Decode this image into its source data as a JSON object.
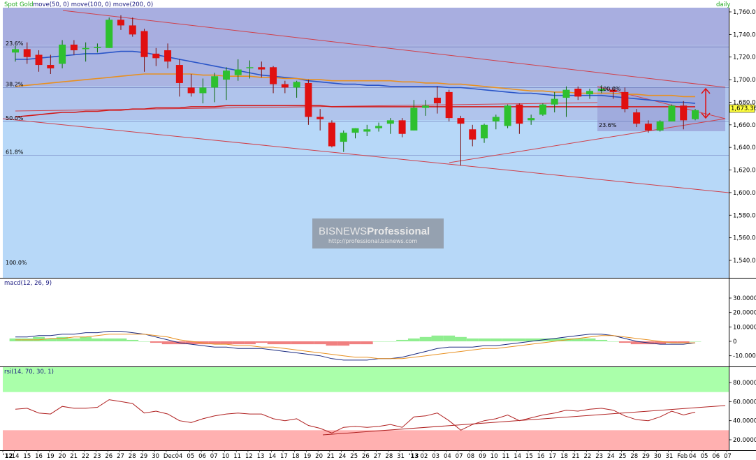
{
  "header": {
    "instrument": "Spot Gold",
    "indicators": "move(50, 0) move(100, 0) move(200, 0)",
    "interval": "daily"
  },
  "colors": {
    "price_bg": "#b7d8f8",
    "fib_band_dark": "#a8b0dc",
    "fib_band_mid": "#aab8e4",
    "bull": "#2ec02e",
    "bear": "#e01010",
    "ma50": "#2a55c8",
    "ma100": "#e89020",
    "ma200": "#d21a1a",
    "trend": "#d0404a",
    "macd_pos": "#90ee90",
    "macd_neg": "#f08080",
    "rsi_over": "#aaffaa",
    "rsi_under": "#ffb0b0",
    "rsi_line": "#b02020"
  },
  "price_panel": {
    "current_price": "1,673.36",
    "y_ticks": [
      "1,760.00",
      "1,740.00",
      "1,720.00",
      "1,700.00",
      "1,680.00",
      "1,660.00",
      "1,640.00",
      "1,620.00",
      "1,600.00",
      "1,580.00",
      "1,560.00",
      "1,540.00"
    ],
    "fib_main": [
      "23.6%",
      "38.2%",
      "50.0%",
      "61.8%",
      "100.0%"
    ],
    "fib_small": [
      "100.0%",
      "23.6%"
    ],
    "watermark_brand": "BISNEWS",
    "watermark_brand2": "Professional",
    "watermark_url": "http://professional.bisnews.com"
  },
  "macd_panel": {
    "title": "macd(12, 26, 9)",
    "y_ticks": [
      "30.0000",
      "20.0000",
      "10.0000",
      "0",
      "-10.0000"
    ]
  },
  "rsi_panel": {
    "title": "rsi(14, 70, 30, 1)",
    "y_ticks": [
      "80.0000",
      "60.0000",
      "40.0000",
      "20.0000"
    ]
  },
  "x_axis": {
    "labels": [
      "'12",
      "14",
      "15",
      "16",
      "19",
      "20",
      "21",
      "22",
      "23",
      "26",
      "27",
      "28",
      "29",
      "30",
      "Dec",
      "04",
      "05",
      "06",
      "07",
      "10",
      "11",
      "12",
      "13",
      "14",
      "17",
      "18",
      "19",
      "20",
      "21",
      "24",
      "25",
      "26",
      "27",
      "28",
      "31",
      "'13",
      "02",
      "03",
      "04",
      "07",
      "08",
      "09",
      "10",
      "11",
      "14",
      "15",
      "16",
      "17",
      "18",
      "21",
      "22",
      "23",
      "24",
      "25",
      "28",
      "29",
      "30",
      "31",
      "Feb",
      "04",
      "05",
      "06",
      "07"
    ]
  },
  "chart_data": {
    "type": "candlestick",
    "title": "Spot Gold daily",
    "x": [
      "14",
      "15",
      "16",
      "19",
      "20",
      "21",
      "22",
      "23",
      "26",
      "27",
      "28",
      "29",
      "30",
      "Dec 03",
      "04",
      "05",
      "06",
      "07",
      "10",
      "11",
      "12",
      "13",
      "14",
      "17",
      "18",
      "19",
      "20",
      "21",
      "24",
      "25",
      "26",
      "27",
      "28",
      "31",
      "'13 01",
      "02",
      "03",
      "04",
      "07",
      "08",
      "09",
      "10",
      "11",
      "14",
      "15",
      "16",
      "17",
      "18",
      "21",
      "22",
      "23",
      "24",
      "25",
      "28",
      "29",
      "30",
      "31",
      "Feb 01",
      "04"
    ],
    "series": [
      {
        "name": "price",
        "ohlc": [
          [
            1724,
            1730,
            1716,
            1727
          ],
          [
            1727,
            1733,
            1714,
            1720
          ],
          [
            1722,
            1726,
            1707,
            1713
          ],
          [
            1713,
            1722,
            1705,
            1710
          ],
          [
            1714,
            1735,
            1710,
            1731
          ],
          [
            1731,
            1735,
            1722,
            1726
          ],
          [
            1727,
            1733,
            1716,
            1728
          ],
          [
            1728,
            1732,
            1724,
            1729
          ],
          [
            1728,
            1755,
            1728,
            1753
          ],
          [
            1753,
            1757,
            1744,
            1748
          ],
          [
            1748,
            1755,
            1738,
            1740
          ],
          [
            1743,
            1745,
            1707,
            1720
          ],
          [
            1723,
            1728,
            1712,
            1719
          ],
          [
            1726,
            1732,
            1710,
            1716
          ],
          [
            1713,
            1718,
            1685,
            1697
          ],
          [
            1693,
            1705,
            1685,
            1688
          ],
          [
            1688,
            1701,
            1679,
            1693
          ],
          [
            1693,
            1706,
            1680,
            1703
          ],
          [
            1700,
            1711,
            1682,
            1708
          ],
          [
            1704,
            1718,
            1699,
            1709
          ],
          [
            1711,
            1717,
            1701,
            1711
          ],
          [
            1711,
            1716,
            1702,
            1709
          ],
          [
            1711,
            1712,
            1688,
            1696
          ],
          [
            1696,
            1699,
            1688,
            1693
          ],
          [
            1693,
            1699,
            1684,
            1698
          ],
          [
            1697,
            1700,
            1660,
            1667
          ],
          [
            1667,
            1674,
            1655,
            1665
          ],
          [
            1662,
            1664,
            1640,
            1641
          ],
          [
            1645,
            1655,
            1636,
            1653
          ],
          [
            1653,
            1657,
            1648,
            1657
          ],
          [
            1654,
            1660,
            1650,
            1656
          ],
          [
            1657,
            1662,
            1654,
            1659
          ],
          [
            1661,
            1666,
            1652,
            1664
          ],
          [
            1664,
            1666,
            1649,
            1652
          ],
          [
            1655,
            1682,
            1655,
            1675
          ],
          [
            1675,
            1682,
            1668,
            1677
          ],
          [
            1684,
            1694,
            1670,
            1679
          ],
          [
            1689,
            1691,
            1663,
            1666
          ],
          [
            1666,
            1668,
            1624,
            1661
          ],
          [
            1656,
            1660,
            1641,
            1647
          ],
          [
            1648,
            1661,
            1644,
            1660
          ],
          [
            1663,
            1669,
            1656,
            1667
          ],
          [
            1659,
            1678,
            1657,
            1677
          ],
          [
            1678,
            1679,
            1652,
            1661
          ],
          [
            1664,
            1669,
            1660,
            1666
          ],
          [
            1669,
            1679,
            1668,
            1678
          ],
          [
            1678,
            1689,
            1671,
            1683
          ],
          [
            1684,
            1694,
            1667,
            1691
          ],
          [
            1692,
            1694,
            1682,
            1685
          ],
          [
            1687,
            1692,
            1683,
            1690
          ],
          [
            1690,
            1695,
            1688,
            1692
          ],
          [
            1691,
            1693,
            1683,
            1689
          ],
          [
            1689,
            1693,
            1671,
            1674
          ],
          [
            1671,
            1674,
            1658,
            1661
          ],
          [
            1661,
            1664,
            1653,
            1655
          ],
          [
            1655,
            1664,
            1654,
            1663
          ],
          [
            1663,
            1678,
            1663,
            1677
          ],
          [
            1677,
            1681,
            1656,
            1664
          ],
          [
            1665,
            1674,
            1664,
            1673
          ]
        ]
      }
    ],
    "moving_averages": [
      {
        "name": "move(50, 0)",
        "values": [
          1718,
          1718,
          1719,
          1720,
          1721,
          1722,
          1723,
          1723,
          1724,
          1725,
          1725,
          1724,
          1722,
          1720,
          1718,
          1716,
          1714,
          1712,
          1710,
          1708,
          1706,
          1704,
          1703,
          1702,
          1701,
          1699,
          1698,
          1697,
          1696,
          1696,
          1695,
          1695,
          1694,
          1694,
          1694,
          1694,
          1694,
          1693,
          1693,
          1692,
          1691,
          1690,
          1689,
          1688,
          1688,
          1687,
          1686,
          1686,
          1686,
          1686,
          1686,
          1685,
          1684,
          1683,
          1682,
          1681,
          1680,
          1680,
          1679
        ]
      },
      {
        "name": "move(100, 0)",
        "values": [
          1694,
          1695,
          1696,
          1697,
          1698,
          1699,
          1700,
          1701,
          1702,
          1703,
          1704,
          1705,
          1705,
          1705,
          1705,
          1705,
          1704,
          1704,
          1703,
          1703,
          1703,
          1702,
          1702,
          1701,
          1701,
          1700,
          1700,
          1699,
          1699,
          1699,
          1699,
          1699,
          1699,
          1698,
          1698,
          1697,
          1697,
          1696,
          1696,
          1695,
          1694,
          1693,
          1692,
          1691,
          1690,
          1690,
          1689,
          1689,
          1688,
          1688,
          1688,
          1688,
          1687,
          1687,
          1686,
          1686,
          1686,
          1685,
          1685
        ]
      },
      {
        "name": "move(200, 0)",
        "values": [
          1667,
          1668,
          1669,
          1670,
          1671,
          1671,
          1672,
          1672,
          1673,
          1673,
          1674,
          1674,
          1675,
          1675,
          1675,
          1676,
          1676,
          1676,
          1677,
          1677,
          1677,
          1677,
          1677,
          1677,
          1677,
          1677,
          1677,
          1676,
          1676,
          1676,
          1676,
          1676,
          1676,
          1676,
          1676,
          1676,
          1676,
          1676,
          1676,
          1676,
          1676,
          1676,
          1676,
          1676,
          1676,
          1676,
          1676,
          1676,
          1676,
          1676,
          1676,
          1676,
          1676,
          1676,
          1676,
          1676,
          1676,
          1676,
          1676
        ]
      }
    ],
    "fibonacci_levels": {
      "23.6%": 1729,
      "38.2%": 1693,
      "50.0%": 1663,
      "61.8%": 1633,
      "100.0%": 1540
    },
    "macd": {
      "series": [
        {
          "name": "macd",
          "values": [
            3,
            3,
            4,
            4,
            5,
            5,
            6,
            6,
            7,
            7,
            6,
            5,
            3,
            1,
            -1,
            -2,
            -3,
            -4,
            -4,
            -5,
            -5,
            -5,
            -6,
            -7,
            -8,
            -9,
            -10,
            -12,
            -13,
            -13,
            -13,
            -12,
            -12,
            -11,
            -9,
            -7,
            -5,
            -4,
            -4,
            -4,
            -3,
            -3,
            -2,
            -1,
            0,
            1,
            2,
            3,
            4,
            5,
            5,
            4,
            2,
            0,
            -1,
            -2,
            -2,
            -2,
            -1
          ]
        },
        {
          "name": "signal",
          "values": [
            1,
            1,
            1,
            2,
            2,
            3,
            3,
            4,
            5,
            5,
            5,
            5,
            4,
            3,
            1,
            0,
            -1,
            -2,
            -2,
            -3,
            -3,
            -4,
            -4,
            -5,
            -6,
            -7,
            -8,
            -9,
            -10,
            -11,
            -11,
            -12,
            -12,
            -12,
            -11,
            -10,
            -9,
            -8,
            -7,
            -6,
            -5,
            -5,
            -4,
            -3,
            -2,
            -1,
            0,
            1,
            2,
            3,
            4,
            4,
            3,
            2,
            1,
            0,
            -1,
            -1,
            -1
          ]
        }
      ],
      "ylim": [
        -15,
        35
      ]
    },
    "rsi": {
      "values": [
        52,
        53,
        48,
        47,
        55,
        53,
        53,
        54,
        62,
        60,
        58,
        48,
        50,
        47,
        40,
        38,
        42,
        45,
        47,
        48,
        47,
        47,
        42,
        40,
        42,
        35,
        32,
        27,
        33,
        34,
        33,
        34,
        36,
        33,
        44,
        45,
        48,
        40,
        30,
        36,
        40,
        42,
        46,
        40,
        43,
        46,
        48,
        51,
        50,
        52,
        53,
        51,
        45,
        41,
        40,
        44,
        50,
        46,
        49
      ],
      "ylim": [
        10,
        90
      ],
      "overbought": 70,
      "oversold": 30
    },
    "ylim": [
      1530,
      1765
    ]
  }
}
